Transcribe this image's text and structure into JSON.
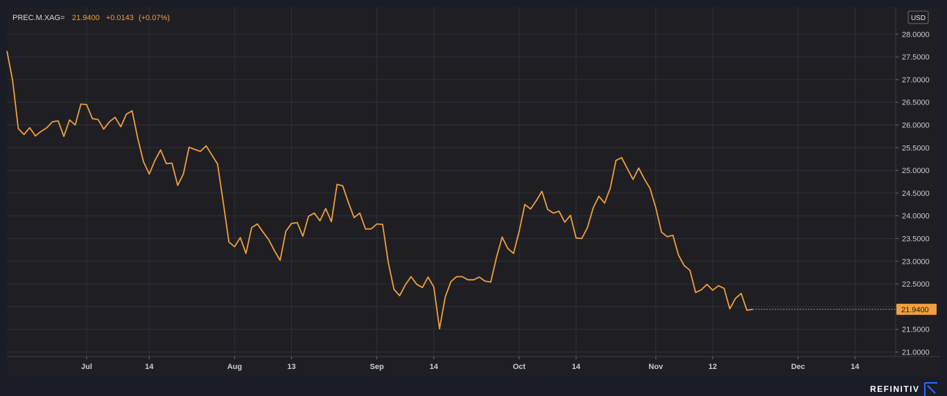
{
  "colors": {
    "page_background": "#1a1c26",
    "plot_background": "#1f1f23",
    "grid": "#2f3036",
    "line": "#f2a03d",
    "text": "#c9ccd3",
    "brand_accent": "#2f6bff"
  },
  "legend": {
    "symbol": "PREC.M.XAG=",
    "last": "21.9400",
    "change": "+0.0143",
    "change_pct": "(+0.07%)"
  },
  "currency": "USD",
  "last_price_label": "21.9400",
  "brand": {
    "name": "REFINITIV",
    "icon": "refinitiv-logo-icon"
  },
  "chart_data": {
    "type": "line",
    "symbol": "PREC.M.XAG=",
    "grid": true,
    "ylim": [
      20.9,
      28.6
    ],
    "y_ticks": [
      "21.0000",
      "21.5000",
      "22.0000",
      "22.5000",
      "23.0000",
      "23.5000",
      "24.0000",
      "24.5000",
      "25.0000",
      "25.5000",
      "26.0000",
      "26.5000",
      "27.0000",
      "27.5000",
      "28.0000"
    ],
    "x_ticks": [
      {
        "label": "Jul",
        "i": 14
      },
      {
        "label": "14",
        "i": 25
      },
      {
        "label": "Aug",
        "i": 40
      },
      {
        "label": "13",
        "i": 50
      },
      {
        "label": "Sep",
        "i": 65
      },
      {
        "label": "14",
        "i": 75
      },
      {
        "label": "Oct",
        "i": 90
      },
      {
        "label": "14",
        "i": 100
      },
      {
        "label": "Nov",
        "i": 114
      },
      {
        "label": "12",
        "i": 124
      },
      {
        "label": "Dec",
        "i": 139
      },
      {
        "label": "14",
        "i": 149
      }
    ],
    "values": [
      27.63,
      26.98,
      25.92,
      25.79,
      25.94,
      25.76,
      25.86,
      25.94,
      26.07,
      26.09,
      25.75,
      26.11,
      26.0,
      26.46,
      26.45,
      26.14,
      26.12,
      25.91,
      26.07,
      26.17,
      25.96,
      26.24,
      26.31,
      25.7,
      25.19,
      24.92,
      25.22,
      25.45,
      25.15,
      25.16,
      24.67,
      24.92,
      25.51,
      25.46,
      25.42,
      25.54,
      25.34,
      25.14,
      24.3,
      23.42,
      23.32,
      23.52,
      23.17,
      23.74,
      23.82,
      23.64,
      23.47,
      23.23,
      23.02,
      23.66,
      23.83,
      23.85,
      23.55,
      23.99,
      24.06,
      23.89,
      24.16,
      23.87,
      24.69,
      24.66,
      24.29,
      23.96,
      24.06,
      23.71,
      23.71,
      23.82,
      23.81,
      22.97,
      22.38,
      22.24,
      22.48,
      22.66,
      22.49,
      22.42,
      22.65,
      22.43,
      21.51,
      22.21,
      22.55,
      22.66,
      22.66,
      22.59,
      22.59,
      22.65,
      22.56,
      22.54,
      23.08,
      23.53,
      23.28,
      23.17,
      23.66,
      24.25,
      24.15,
      24.33,
      24.54,
      24.14,
      24.06,
      24.1,
      23.86,
      24.01,
      23.51,
      23.5,
      23.74,
      24.17,
      24.43,
      24.28,
      24.61,
      25.22,
      25.28,
      25.04,
      24.8,
      25.05,
      24.81,
      24.6,
      24.18,
      23.64,
      23.54,
      23.57,
      23.13,
      22.9,
      22.8,
      22.31,
      22.37,
      22.49,
      22.36,
      22.46,
      22.4,
      21.95,
      22.18,
      22.29,
      21.92,
      21.94
    ]
  }
}
